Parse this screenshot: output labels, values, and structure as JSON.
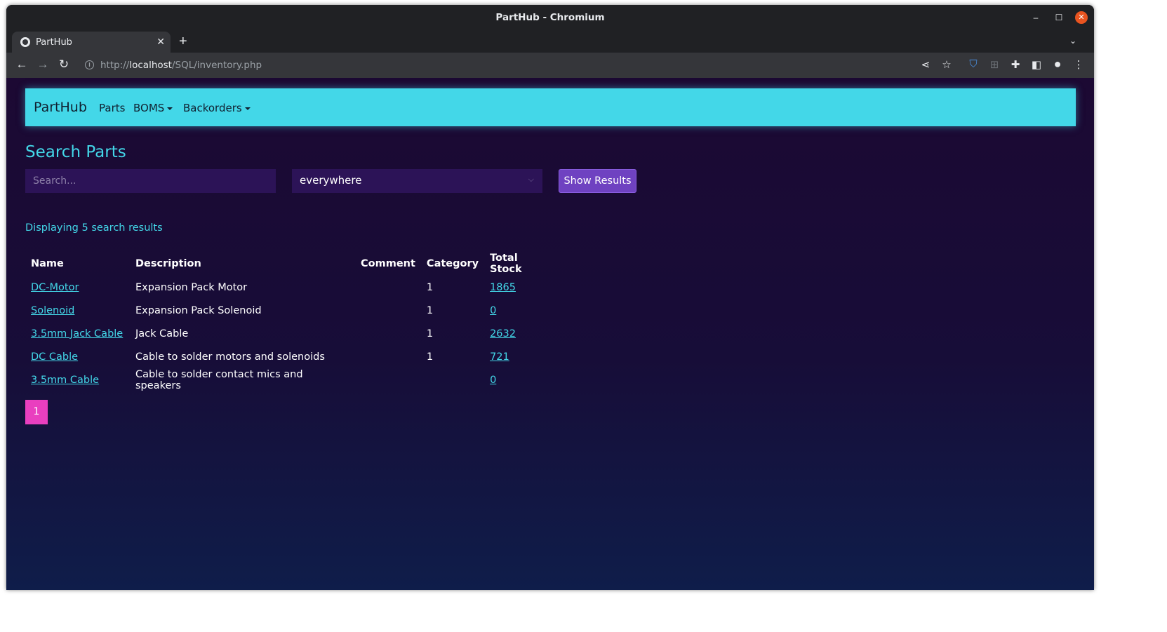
{
  "browser": {
    "window_title": "PartHub - Chromium",
    "tab_title": "PartHub",
    "url_scheme": "http://",
    "url_host": "localhost",
    "url_path": "/SQL/inventory.php"
  },
  "navbar": {
    "brand": "PartHub",
    "links": [
      "Parts",
      "BOMS",
      "Backorders"
    ]
  },
  "search": {
    "heading": "Search Parts",
    "placeholder": "Search...",
    "scope_value": "everywhere",
    "button_label": "Show Results"
  },
  "results": {
    "count_text": "Displaying 5 search results",
    "columns": [
      "Name",
      "Description",
      "Comment",
      "Category",
      "Total Stock"
    ],
    "rows": [
      {
        "name": "DC-Motor",
        "description": "Expansion Pack Motor",
        "comment": "",
        "category": "1",
        "stock": "1865"
      },
      {
        "name": "Solenoid",
        "description": "Expansion Pack Solenoid",
        "comment": "",
        "category": "1",
        "stock": "0"
      },
      {
        "name": "3.5mm Jack Cable",
        "description": "Jack Cable",
        "comment": "",
        "category": "1",
        "stock": "2632"
      },
      {
        "name": "DC Cable",
        "description": "Cable to solder motors and solenoids",
        "comment": "",
        "category": "1",
        "stock": "721"
      },
      {
        "name": "3.5mm Cable",
        "description": "Cable to solder contact mics and speakers",
        "comment": "",
        "category": "",
        "stock": "0"
      }
    ]
  },
  "pagination": {
    "current_page": "1"
  },
  "colors": {
    "accent_cyan": "#43d7e8",
    "button_purple": "#6f42c1",
    "pager_pink": "#e93fbf",
    "background": "#1c0933"
  }
}
